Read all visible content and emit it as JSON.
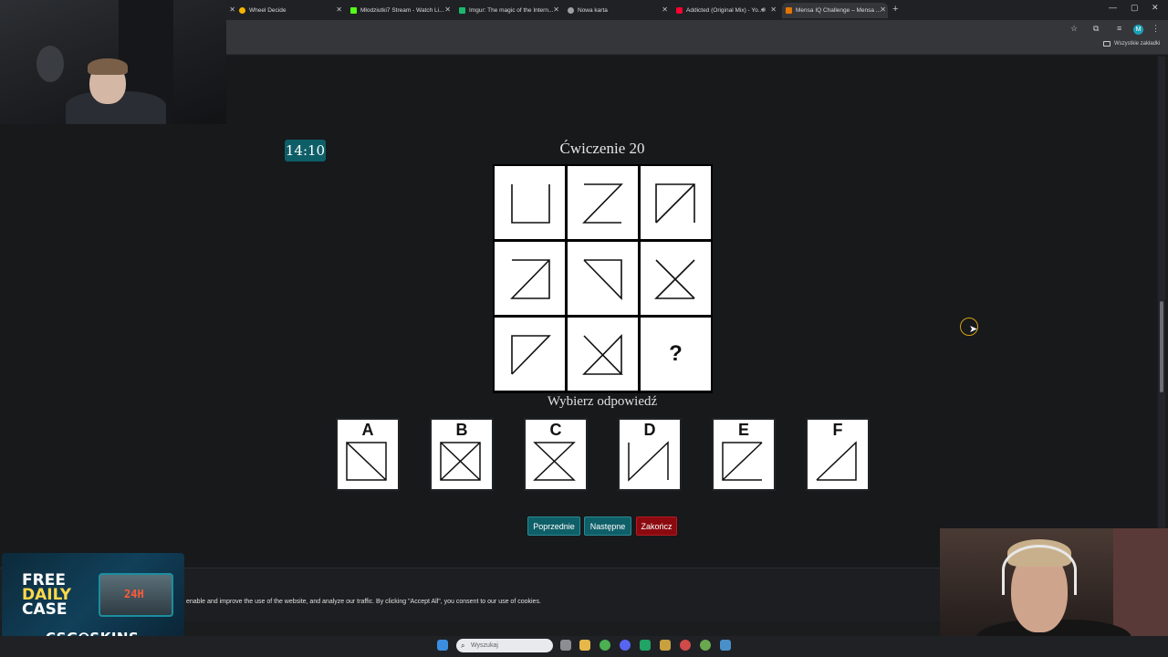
{
  "browser": {
    "tabs": [
      {
        "title": "Wheel Decide",
        "color": "#f4b400"
      },
      {
        "title": "Młodziutki7 Stream - Watch Li...",
        "color": "#53fc18"
      },
      {
        "title": "Imgur: The magic of the Intern...",
        "color": "#1bb76e"
      },
      {
        "title": "Nowa karta",
        "color": "#9aa0a6"
      },
      {
        "title": "Addicted (Original Mix) - Yo...",
        "color": "#ff0033"
      },
      {
        "title": "Mensa IQ Challenge – Mensa ...",
        "color": "#e37400"
      }
    ],
    "bookmarks_all": "Wszystkie zakładki",
    "profile_initial": "M"
  },
  "quiz": {
    "timer": "14:10",
    "title": "Ćwiczenie 20",
    "question_mark": "?",
    "choose_label": "Wybierz odpowiedź",
    "options": [
      "A",
      "B",
      "C",
      "D",
      "E",
      "F"
    ],
    "buttons": {
      "prev": "Poprzednie",
      "next": "Następne",
      "end": "Zakończ"
    }
  },
  "cookie_text": "enable and improve the use of the website, and analyze our traffic. By clicking \"Accept All\", you consent to our use of cookies.",
  "promo": {
    "line1": "FREE",
    "line2": "DAILY",
    "line3": "CASE",
    "badge": "24H",
    "brand": "CSG⭘SKINS"
  },
  "taskbar": {
    "search_placeholder": "Wyszukaj"
  }
}
